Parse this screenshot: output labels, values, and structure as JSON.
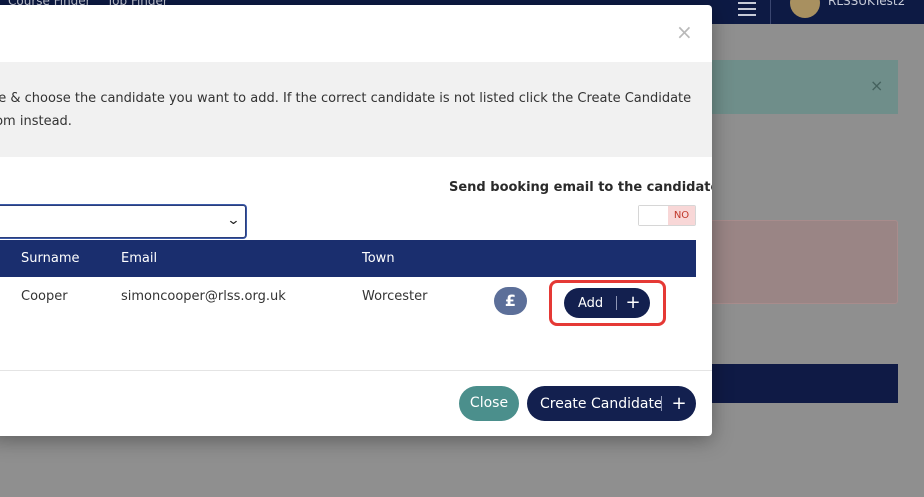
{
  "background": {
    "nav_items": [
      "Course Finder",
      "Job Finder"
    ],
    "username": "RLSSUKTest2",
    "alert_close": "×"
  },
  "modal": {
    "close_symbol": "×",
    "instructions": [
      "pe & choose the candidate you want to add. If the correct candidate is not listed click the Create Candidate",
      "tom instead."
    ],
    "send_email_label": "Send booking email to the candidate?",
    "toggle": {
      "value": "NO",
      "state": false
    },
    "candidate_select": {
      "value": "",
      "chevron": "⌄"
    },
    "table": {
      "columns": [
        "Surname",
        "Email",
        "Town"
      ],
      "rows": [
        {
          "surname": "Cooper",
          "email": "simoncooper@rlss.org.uk",
          "town": "Worcester"
        }
      ]
    },
    "pound_symbol": "£",
    "add_label": "Add",
    "plus_symbol": "+",
    "close_label": "Close",
    "create_label": "Create Candidate"
  },
  "colors": {
    "navy": "#13204f",
    "table_header": "#1a2e6e",
    "teal_button": "#4b8f8c",
    "highlight": "#e53935",
    "toggle_no": "#f8d7d7"
  }
}
